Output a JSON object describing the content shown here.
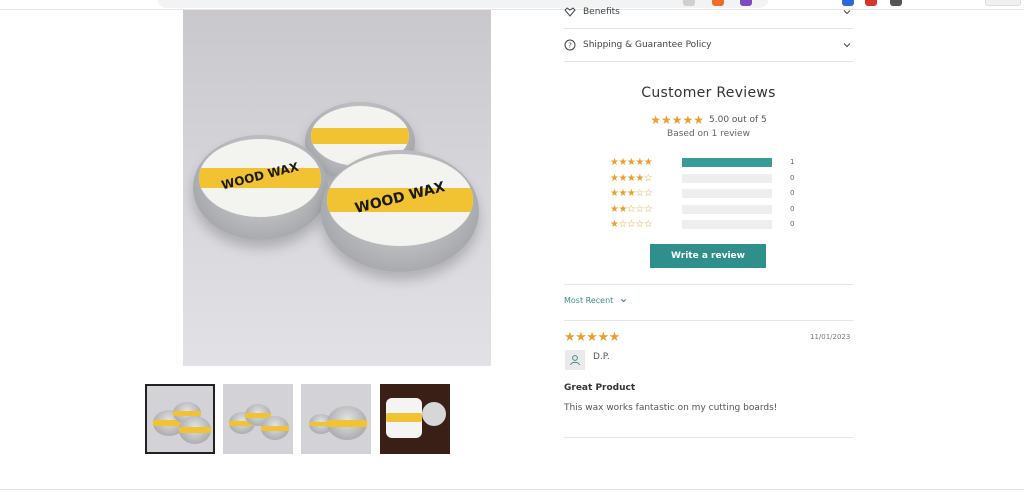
{
  "accordion": [
    {
      "label": "Benefits",
      "icon": "heart-icon"
    },
    {
      "label": "Shipping & Guarantee Policy",
      "icon": "question-circle-icon"
    }
  ],
  "reviews": {
    "title": "Customer Reviews",
    "average_stars": "★★★★★",
    "average_text": "5.00 out of 5",
    "based_on": "Based on 1 review",
    "histogram": [
      {
        "stars": "★★★★★",
        "count": "1",
        "fraction": 1.0
      },
      {
        "stars": "★★★★☆",
        "count": "0",
        "fraction": 0
      },
      {
        "stars": "★★★☆☆",
        "count": "0",
        "fraction": 0
      },
      {
        "stars": "★★☆☆☆",
        "count": "0",
        "fraction": 0
      },
      {
        "stars": "★☆☆☆☆",
        "count": "0",
        "fraction": 0
      }
    ],
    "write_review_label": "Write a review",
    "sort_label": "Most Recent",
    "items": [
      {
        "stars": "★★★★★",
        "date": "11/01/2023",
        "reviewer": "D.P.",
        "title": "Great Product",
        "body": "This wax works fantastic on my cutting boards!"
      }
    ]
  },
  "product": {
    "tin_label": "WOOD WAX"
  },
  "colors": {
    "accent": "#2f8f8a",
    "star": "#e7a12c",
    "label_yellow": "#f1c232"
  }
}
